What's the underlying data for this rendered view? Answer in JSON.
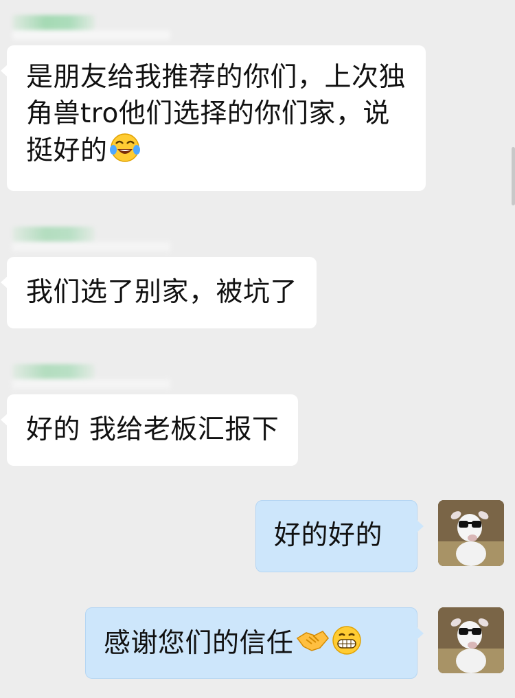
{
  "messages": [
    {
      "side": "in",
      "text": "是朋友给我推荐的你们，上次独角兽tro他们选择的你们家，说挺好的",
      "emoji": "tears-of-joy-emoji"
    },
    {
      "side": "in",
      "text": "我们选了别家，被坑了"
    },
    {
      "side": "in",
      "text": "好的 我给老板汇报下"
    },
    {
      "side": "out",
      "text": "好的好的"
    },
    {
      "side": "out",
      "text": "感谢您们的信任",
      "emoji": [
        "handshake-emoji",
        "grinning-emoji"
      ]
    }
  ],
  "colors": {
    "background": "#ededed",
    "incoming_bubble": "#ffffff",
    "outgoing_bubble": "#cde6fb"
  }
}
